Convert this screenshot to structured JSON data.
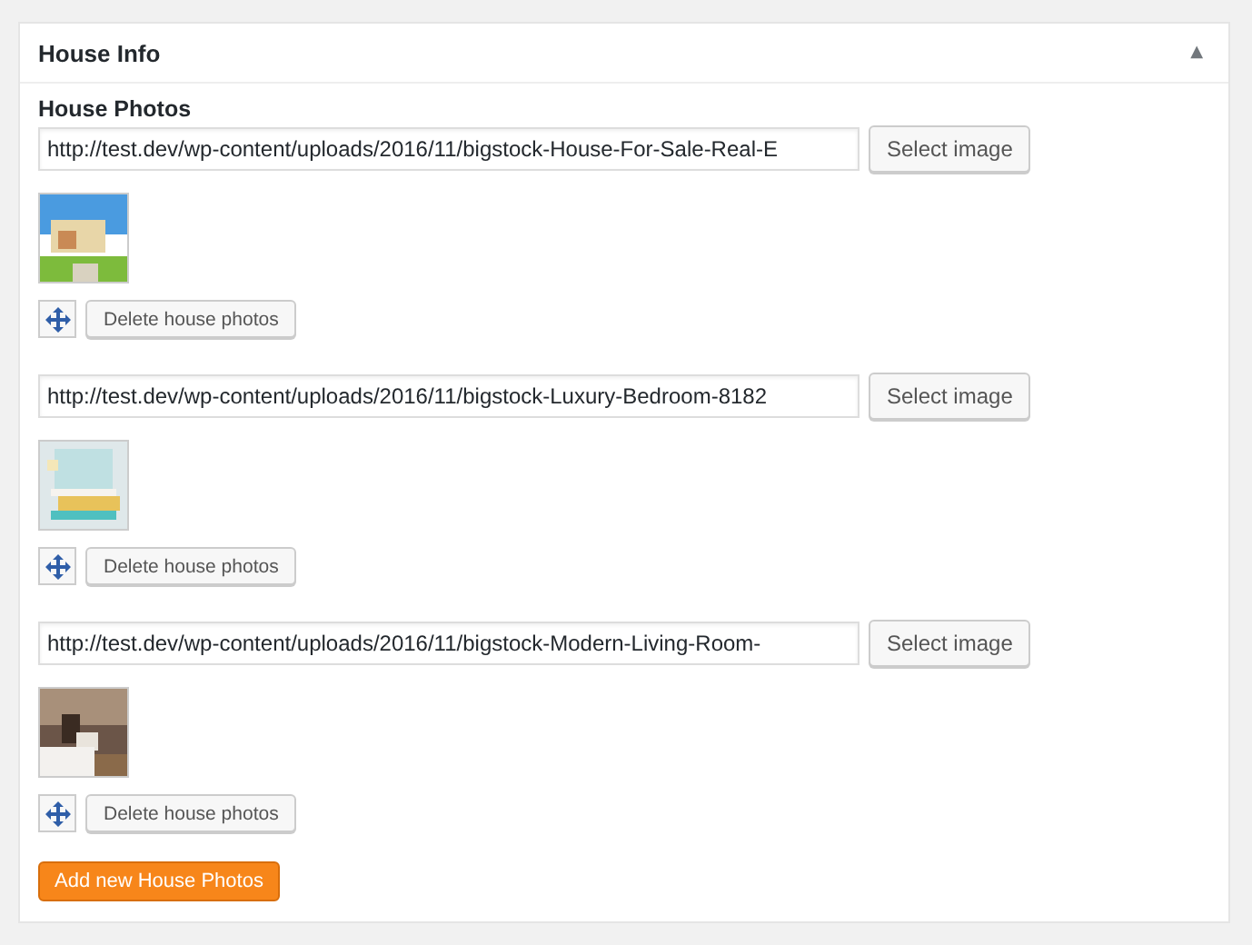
{
  "panel": {
    "title": "House Info",
    "collapse_icon": "▲"
  },
  "field_label": "House Photos",
  "photos": [
    {
      "url": "http://test.dev/wp-content/uploads/2016/11/bigstock-House-For-Sale-Real-E",
      "select_button": "Select image",
      "delete_button": "Delete house photos"
    },
    {
      "url": "http://test.dev/wp-content/uploads/2016/11/bigstock-Luxury-Bedroom-8182",
      "select_button": "Select image",
      "delete_button": "Delete house photos"
    },
    {
      "url": "http://test.dev/wp-content/uploads/2016/11/bigstock-Modern-Living-Room-",
      "select_button": "Select image",
      "delete_button": "Delete house photos"
    }
  ],
  "add_button": "Add new House Photos"
}
